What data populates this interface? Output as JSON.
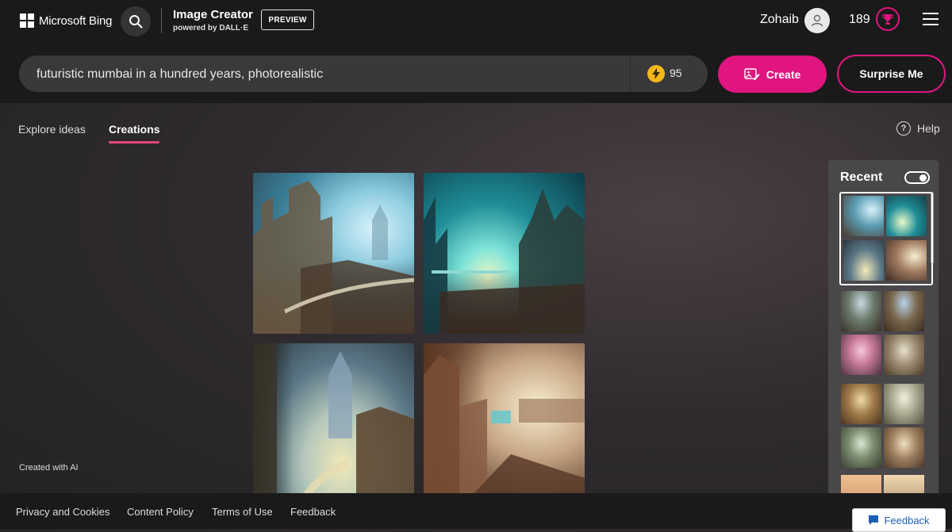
{
  "header": {
    "brand": "Microsoft Bing",
    "app_title": "Image Creator",
    "powered_by": "powered by DALL·E",
    "preview_badge": "PREVIEW",
    "user_name": "Zohaib",
    "rewards_points": "189"
  },
  "prompt": {
    "value": "futuristic mumbai in a hundred years, photorealistic",
    "boosts": "95"
  },
  "actions": {
    "create_label": "Create",
    "surprise_label": "Surprise Me"
  },
  "tabs": [
    {
      "label": "Explore ideas",
      "active": false
    },
    {
      "label": "Creations",
      "active": true
    }
  ],
  "help_label": "Help",
  "created_with_ai": "Created with AI",
  "recent": {
    "title": "Recent",
    "toggle_on": true
  },
  "footer": {
    "links": [
      "Privacy and Cookies",
      "Content Policy",
      "Terms of Use",
      "Feedback"
    ],
    "feedback_button": "Feedback"
  },
  "colors": {
    "accent": "#e0157f",
    "header_bg": "#1b1a1b",
    "boost": "#f3b61c"
  }
}
